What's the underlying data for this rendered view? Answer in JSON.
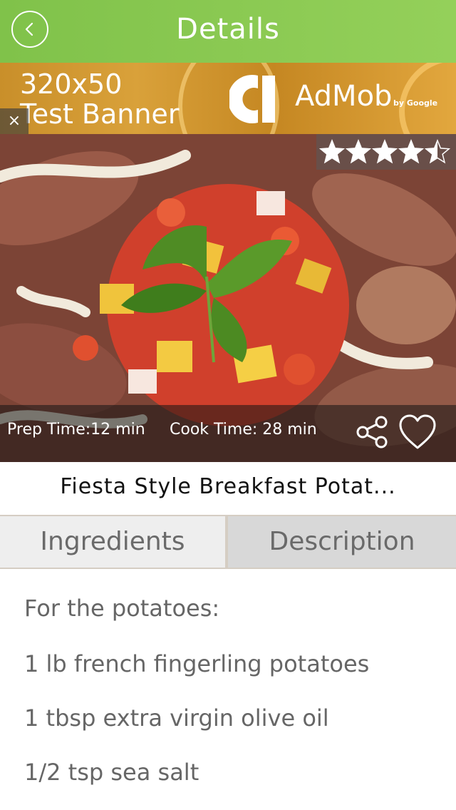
{
  "header": {
    "title": "Details"
  },
  "ad": {
    "line1": "320x50",
    "line2": "Test Banner",
    "close": "×",
    "brand": "AdMob",
    "by": "by Google"
  },
  "recipe": {
    "rating": 4.5,
    "prep_label": "Prep Time:12 min",
    "cook_label": "Cook Time:  28 min",
    "title": "Fiesta Style Breakfast Potat..."
  },
  "tabs": [
    {
      "label": "Ingredients"
    },
    {
      "label": "Description"
    }
  ],
  "ingredients": [
    "For the potatoes:",
    "1 lb french fingerling potatoes",
    "1 tbsp extra virgin olive oil",
    "1/2 tsp sea salt"
  ],
  "colors": {
    "header": "#8cc952",
    "ad_gold": "#d39a35",
    "text_dark": "#111111",
    "text_gray": "#666666"
  }
}
